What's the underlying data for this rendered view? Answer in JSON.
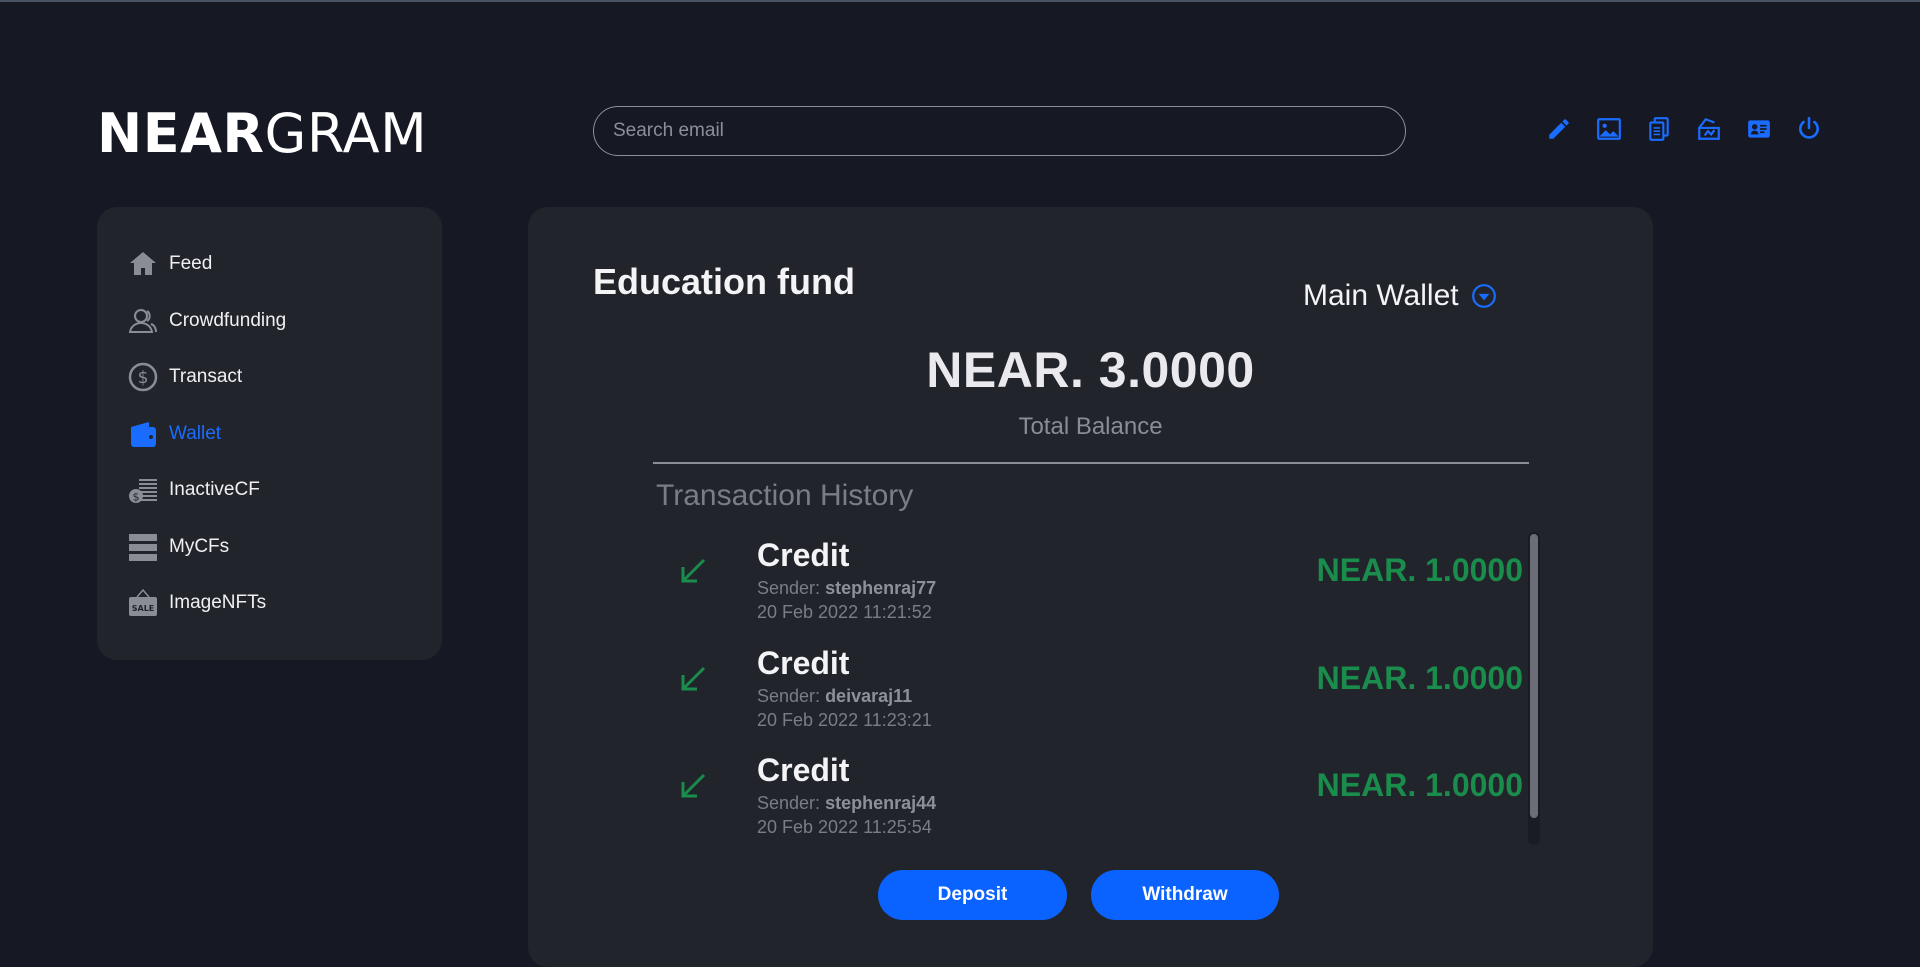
{
  "header": {
    "logo_bold": "NEAR",
    "logo_thin": "GRAM",
    "search_placeholder": "Search email",
    "icons": [
      "edit-icon",
      "image-icon",
      "documents-icon",
      "fundraiser-icon",
      "id-card-icon",
      "power-icon"
    ]
  },
  "sidebar": {
    "items": [
      {
        "label": "Feed",
        "icon": "home-icon"
      },
      {
        "label": "Crowdfunding",
        "icon": "people-icon"
      },
      {
        "label": "Transact",
        "icon": "dollar-circle-icon"
      },
      {
        "label": "Wallet",
        "icon": "wallet-icon",
        "active": true
      },
      {
        "label": "InactiveCF",
        "icon": "cash-stack-icon"
      },
      {
        "label": "MyCFs",
        "icon": "list-icon"
      },
      {
        "label": "ImageNFTs",
        "icon": "sale-tag-icon"
      }
    ]
  },
  "main": {
    "title": "Education fund",
    "wallet_select": "Main Wallet",
    "balance": "NEAR. 3.0000",
    "balance_label": "Total Balance",
    "history_title": "Transaction History",
    "sender_prefix": "Sender:",
    "transactions": [
      {
        "type": "Credit",
        "sender": "stephenraj77",
        "date": "20 Feb 2022 11:21:52",
        "amount": "NEAR. 1.0000"
      },
      {
        "type": "Credit",
        "sender": "deivaraj11",
        "date": "20 Feb 2022 11:23:21",
        "amount": "NEAR. 1.0000"
      },
      {
        "type": "Credit",
        "sender": "stephenraj44",
        "date": "20 Feb 2022 11:25:54",
        "amount": "NEAR. 1.0000"
      }
    ],
    "deposit_label": "Deposit",
    "withdraw_label": "Withdraw"
  },
  "colors": {
    "background": "#161823",
    "card": "#22242c",
    "accent": "#0a63ff",
    "credit": "#1a8c4c"
  }
}
